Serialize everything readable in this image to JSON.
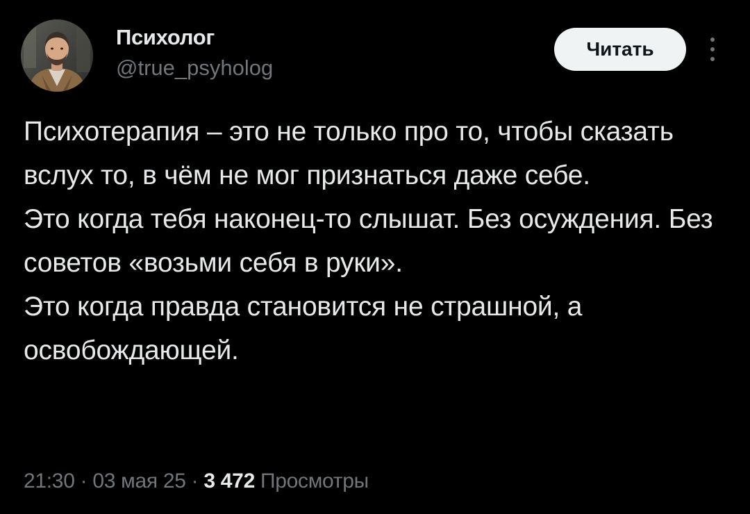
{
  "author": {
    "name": "Психолог",
    "handle": "@true_psyholog"
  },
  "follow_button": {
    "label": "Читать"
  },
  "more_button": {
    "icon": "more-vertical-icon"
  },
  "tweet": {
    "text": "Психотерапия – это не только про то, чтобы сказать вслух то, в чём не мог признаться даже себе.\nЭто когда тебя наконец-то слышат. Без осуждения. Без советов «возьми себя в руки».\nЭто когда правда становится не страшной, а освобождающей.",
    "time": "21:30",
    "date": "03 мая 25",
    "separator": " · ",
    "views_count": "3 472",
    "views_label": "Просмотры"
  },
  "colors": {
    "background": "#000000",
    "text_primary": "#e7e9ea",
    "text_secondary": "#71767b",
    "button_bg": "#eff3f4",
    "button_text": "#0f1419"
  }
}
